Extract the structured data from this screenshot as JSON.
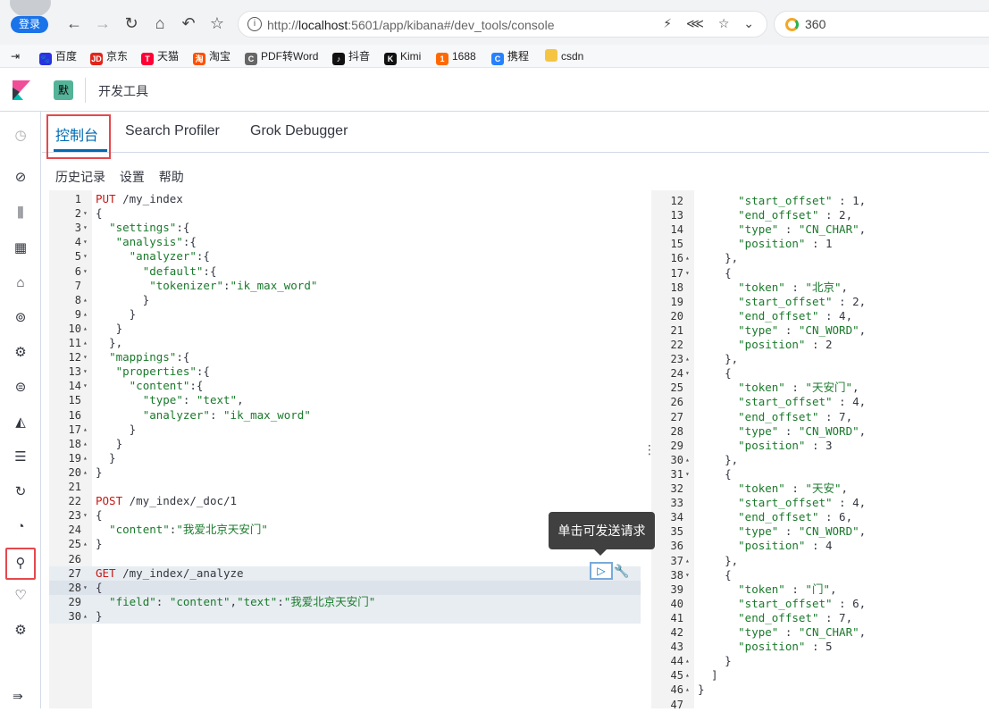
{
  "browser": {
    "login_label": "登录",
    "url_prefix": "http://",
    "url_host": "localhost",
    "url_path": ":5601/app/kibana#/dev_tools/console",
    "search_engine": "360",
    "address_tools": "⚡ ⋘ ☆ ⌄"
  },
  "bookmarks": [
    {
      "label": "百度",
      "icon": "baidu-icon",
      "color": "#2932e1",
      "glyph": "🐾"
    },
    {
      "label": "京东",
      "icon": "jd-icon",
      "color": "#e1251b",
      "glyph": "JD"
    },
    {
      "label": "天猫",
      "icon": "tmall-icon",
      "color": "#ff0036",
      "glyph": "T"
    },
    {
      "label": "淘宝",
      "icon": "taobao-icon",
      "color": "#ff5000",
      "glyph": "淘"
    },
    {
      "label": "PDF转Word",
      "icon": "pdf-icon",
      "color": "#666666",
      "glyph": "C"
    },
    {
      "label": "抖音",
      "icon": "douyin-icon",
      "color": "#111111",
      "glyph": "♪"
    },
    {
      "label": "Kimi",
      "icon": "kimi-icon",
      "color": "#111111",
      "glyph": "K"
    },
    {
      "label": "1688",
      "icon": "1688-icon",
      "color": "#ff6a00",
      "glyph": "1"
    },
    {
      "label": "携程",
      "icon": "ctrip-icon",
      "color": "#2681ff",
      "glyph": "C"
    },
    {
      "label": "csdn",
      "icon": "folder-icon",
      "color": "#f5c542",
      "glyph": ""
    }
  ],
  "header": {
    "space_initial": "默",
    "title": "开发工具"
  },
  "tabs": [
    {
      "label": "控制台",
      "active": true
    },
    {
      "label": "Search Profiler",
      "active": false
    },
    {
      "label": "Grok Debugger",
      "active": false
    }
  ],
  "menu": [
    "历史记录",
    "设置",
    "帮助"
  ],
  "tooltip": "单击可发送请求",
  "editor_lines": [
    {
      "n": "1",
      "f": "",
      "t": "<span class=\"m\">PUT</span> /my_index"
    },
    {
      "n": "2",
      "f": "▾",
      "t": "{"
    },
    {
      "n": "3",
      "f": "▾",
      "t": "  <span class=\"s\">\"settings\"</span>:{"
    },
    {
      "n": "4",
      "f": "▾",
      "t": "   <span class=\"s\">\"analysis\"</span>:{"
    },
    {
      "n": "5",
      "f": "▾",
      "t": "     <span class=\"s\">\"analyzer\"</span>:{"
    },
    {
      "n": "6",
      "f": "▾",
      "t": "       <span class=\"s\">\"default\"</span>:{"
    },
    {
      "n": "7",
      "f": "",
      "t": "        <span class=\"s\">\"tokenizer\"</span>:<span class=\"s\">\"ik_max_word\"</span>"
    },
    {
      "n": "8",
      "f": "▴",
      "t": "       }"
    },
    {
      "n": "9",
      "f": "▴",
      "t": "     }"
    },
    {
      "n": "10",
      "f": "▴",
      "t": "   }"
    },
    {
      "n": "11",
      "f": "▴",
      "t": "  },"
    },
    {
      "n": "12",
      "f": "▾",
      "t": "  <span class=\"s\">\"mappings\"</span>:{"
    },
    {
      "n": "13",
      "f": "▾",
      "t": "   <span class=\"s\">\"properties\"</span>:{"
    },
    {
      "n": "14",
      "f": "▾",
      "t": "     <span class=\"s\">\"content\"</span>:{"
    },
    {
      "n": "15",
      "f": "",
      "t": "       <span class=\"s\">\"type\"</span>: <span class=\"s\">\"text\"</span>,"
    },
    {
      "n": "16",
      "f": "",
      "t": "       <span class=\"s\">\"analyzer\"</span>: <span class=\"s\">\"ik_max_word\"</span>"
    },
    {
      "n": "17",
      "f": "▴",
      "t": "     }"
    },
    {
      "n": "18",
      "f": "▴",
      "t": "   }"
    },
    {
      "n": "19",
      "f": "▴",
      "t": "  }"
    },
    {
      "n": "20",
      "f": "▴",
      "t": "}"
    },
    {
      "n": "21",
      "f": "",
      "t": ""
    },
    {
      "n": "22",
      "f": "",
      "t": "<span class=\"m\">POST</span> /my_index/_doc/1"
    },
    {
      "n": "23",
      "f": "▾",
      "t": "{"
    },
    {
      "n": "24",
      "f": "",
      "t": "  <span class=\"s\">\"content\"</span>:<span class=\"s\">\"我爱北京天安门\"</span>"
    },
    {
      "n": "25",
      "f": "▴",
      "t": "}"
    },
    {
      "n": "26",
      "f": "",
      "t": ""
    },
    {
      "n": "27",
      "f": "",
      "t": "<span class=\"m\">GET</span> /my_index/_analyze",
      "hl": true
    },
    {
      "n": "28",
      "f": "▾",
      "t": "{",
      "hl": true,
      "active": true
    },
    {
      "n": "29",
      "f": "",
      "t": "  <span class=\"s\">\"field\"</span>: <span class=\"s\">\"content\"</span>,<span class=\"s\">\"text\"</span>:<span class=\"s\">\"我爱北京天安门\"</span>",
      "hl": true
    },
    {
      "n": "30",
      "f": "▴",
      "t": "}",
      "hl": true
    }
  ],
  "output_lines": [
    {
      "n": "12",
      "f": "",
      "t": "      <span class=\"s\">\"start_offset\"</span> : 1,"
    },
    {
      "n": "13",
      "f": "",
      "t": "      <span class=\"s\">\"end_offset\"</span> : 2,"
    },
    {
      "n": "14",
      "f": "",
      "t": "      <span class=\"s\">\"type\"</span> : <span class=\"s\">\"CN_CHAR\"</span>,"
    },
    {
      "n": "15",
      "f": "",
      "t": "      <span class=\"s\">\"position\"</span> : 1"
    },
    {
      "n": "16",
      "f": "▴",
      "t": "    },"
    },
    {
      "n": "17",
      "f": "▾",
      "t": "    {"
    },
    {
      "n": "18",
      "f": "",
      "t": "      <span class=\"s\">\"token\"</span> : <span class=\"s\">\"北京\"</span>,"
    },
    {
      "n": "19",
      "f": "",
      "t": "      <span class=\"s\">\"start_offset\"</span> : 2,"
    },
    {
      "n": "20",
      "f": "",
      "t": "      <span class=\"s\">\"end_offset\"</span> : 4,"
    },
    {
      "n": "21",
      "f": "",
      "t": "      <span class=\"s\">\"type\"</span> : <span class=\"s\">\"CN_WORD\"</span>,"
    },
    {
      "n": "22",
      "f": "",
      "t": "      <span class=\"s\">\"position\"</span> : 2"
    },
    {
      "n": "23",
      "f": "▴",
      "t": "    },"
    },
    {
      "n": "24",
      "f": "▾",
      "t": "    {"
    },
    {
      "n": "25",
      "f": "",
      "t": "      <span class=\"s\">\"token\"</span> : <span class=\"s\">\"天安门\"</span>,"
    },
    {
      "n": "26",
      "f": "",
      "t": "      <span class=\"s\">\"start_offset\"</span> : 4,"
    },
    {
      "n": "27",
      "f": "",
      "t": "      <span class=\"s\">\"end_offset\"</span> : 7,"
    },
    {
      "n": "28",
      "f": "",
      "t": "      <span class=\"s\">\"type\"</span> : <span class=\"s\">\"CN_WORD\"</span>,"
    },
    {
      "n": "29",
      "f": "",
      "t": "      <span class=\"s\">\"position\"</span> : 3"
    },
    {
      "n": "30",
      "f": "▴",
      "t": "    },"
    },
    {
      "n": "31",
      "f": "▾",
      "t": "    {"
    },
    {
      "n": "32",
      "f": "",
      "t": "      <span class=\"s\">\"token\"</span> : <span class=\"s\">\"天安\"</span>,"
    },
    {
      "n": "33",
      "f": "",
      "t": "      <span class=\"s\">\"start_offset\"</span> : 4,"
    },
    {
      "n": "34",
      "f": "",
      "t": "      <span class=\"s\">\"end_offset\"</span> : 6,"
    },
    {
      "n": "35",
      "f": "",
      "t": "      <span class=\"s\">\"type\"</span> : <span class=\"s\">\"CN_WORD\"</span>,"
    },
    {
      "n": "36",
      "f": "",
      "t": "      <span class=\"s\">\"position\"</span> : 4"
    },
    {
      "n": "37",
      "f": "▴",
      "t": "    },"
    },
    {
      "n": "38",
      "f": "▾",
      "t": "    {"
    },
    {
      "n": "39",
      "f": "",
      "t": "      <span class=\"s\">\"token\"</span> : <span class=\"s\">\"门\"</span>,"
    },
    {
      "n": "40",
      "f": "",
      "t": "      <span class=\"s\">\"start_offset\"</span> : 6,"
    },
    {
      "n": "41",
      "f": "",
      "t": "      <span class=\"s\">\"end_offset\"</span> : 7,"
    },
    {
      "n": "42",
      "f": "",
      "t": "      <span class=\"s\">\"type\"</span> : <span class=\"s\">\"CN_CHAR\"</span>,"
    },
    {
      "n": "43",
      "f": "",
      "t": "      <span class=\"s\">\"position\"</span> : 5"
    },
    {
      "n": "44",
      "f": "▴",
      "t": "    }"
    },
    {
      "n": "45",
      "f": "▴",
      "t": "  ]"
    },
    {
      "n": "46",
      "f": "▴",
      "t": "}"
    },
    {
      "n": "47",
      "f": "",
      "t": ""
    }
  ],
  "nav_icons": [
    "clock-icon",
    "compass-icon",
    "visualize-icon",
    "dashboard-icon",
    "canvas-icon",
    "maps-icon",
    "ml-icon",
    "infrastructure-icon",
    "logs-icon",
    "apm-icon",
    "uptime-icon",
    "siem-icon",
    "dev-tools-icon",
    "monitoring-icon",
    "management-icon",
    "collapse-icon"
  ]
}
